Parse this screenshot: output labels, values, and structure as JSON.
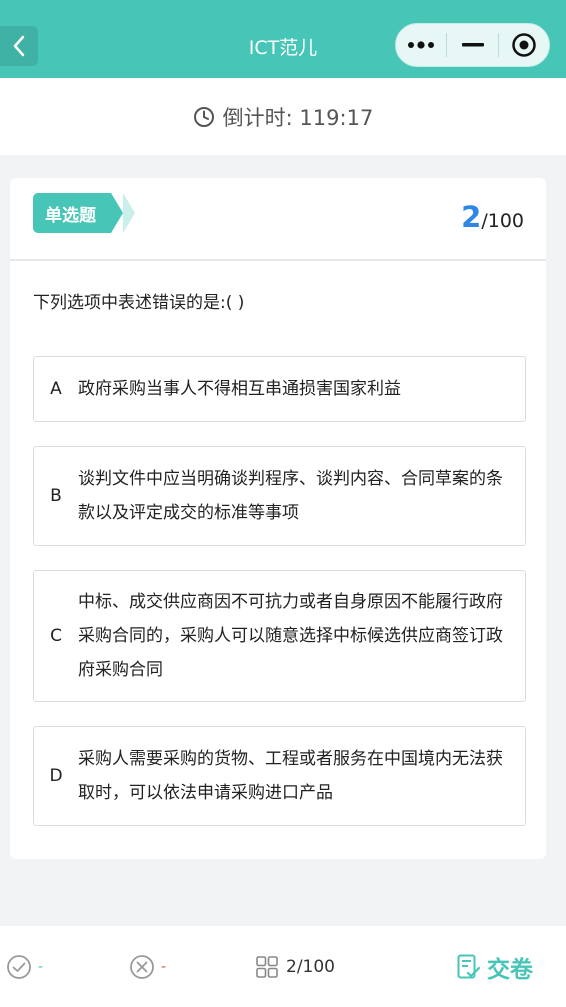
{
  "header": {
    "title": "ICT范儿"
  },
  "timer": {
    "label": "倒计时: 119:17"
  },
  "question_card": {
    "type_label": "单选题",
    "current": "2",
    "total": "/100",
    "question": "下列选项中表述错误的是:(     )",
    "options": [
      {
        "letter": "A",
        "text": "政府采购当事人不得相互串通损害国家利益"
      },
      {
        "letter": "B",
        "text": "谈判文件中应当明确谈判程序、谈判内容、合同草案的条款以及评定成交的标准等事项"
      },
      {
        "letter": "C",
        "text": "中标、成交供应商因不可抗力或者自身原因不能履行政府采购合同的，采购人可以随意选择中标候选供应商签订政府采购合同"
      },
      {
        "letter": "D",
        "text": "采购人需要采购的货物、工程或者服务在中国境内无法获取时，可以依法申请采购进口产品"
      }
    ]
  },
  "bottom_bar": {
    "correct_count": "-",
    "wrong_count": "-",
    "progress": "2/100",
    "submit_label": "交卷"
  },
  "colors": {
    "accent": "#47c5b7",
    "counter_blue": "#2e87e6",
    "wrong_red": "#e0534a"
  }
}
